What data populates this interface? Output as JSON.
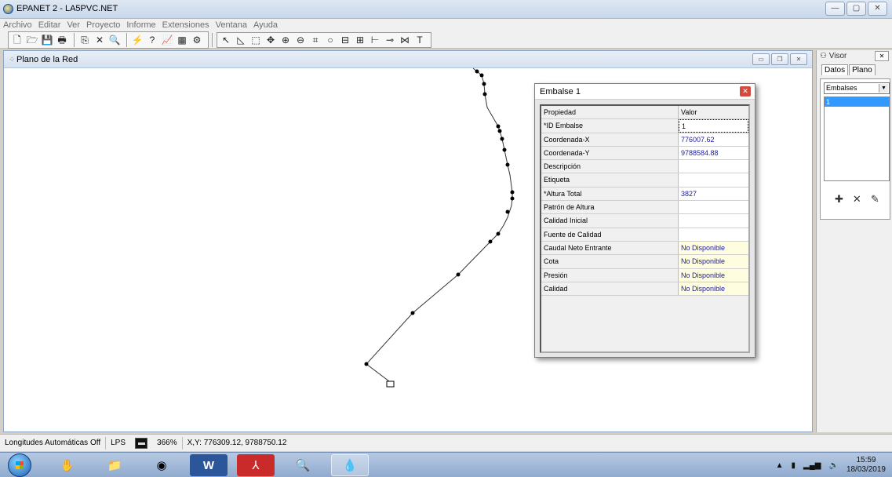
{
  "app": {
    "title": "EPANET 2 - LA5PVC.NET",
    "window_buttons": [
      "—",
      "▢",
      "✕"
    ]
  },
  "menu": [
    "Archivo",
    "Editar",
    "Ver",
    "Proyecto",
    "Informe",
    "Extensiones",
    "Ventana",
    "Ayuda"
  ],
  "network_window": {
    "title": "Plano de la Red"
  },
  "dialog": {
    "title": "Embalse 1",
    "header": {
      "name": "Propiedad",
      "value": "Valor"
    },
    "rows": [
      {
        "name": "*ID Embalse",
        "value": "1"
      },
      {
        "name": "Coordenada-X",
        "value": "776007.62"
      },
      {
        "name": "Coordenada-Y",
        "value": "9788584.88"
      },
      {
        "name": "Descripción",
        "value": ""
      },
      {
        "name": "Etiqueta",
        "value": ""
      },
      {
        "name": "*Altura Total",
        "value": "3827"
      },
      {
        "name": "Patrón de Altura",
        "value": ""
      },
      {
        "name": "Calidad Inicial",
        "value": ""
      },
      {
        "name": "Fuente de Calidad",
        "value": ""
      },
      {
        "name": "Caudal Neto Entrante",
        "value": "No Disponible"
      },
      {
        "name": "Cota",
        "value": "No Disponible"
      },
      {
        "name": "Presión",
        "value": "No Disponible"
      },
      {
        "name": "Calidad",
        "value": "No Disponible"
      }
    ]
  },
  "visor": {
    "title": "Visor",
    "tabs": [
      "Datos",
      "Plano"
    ],
    "selected_category": "Embalses",
    "items": [
      "1"
    ]
  },
  "status": {
    "auto_length": "Longitudes Automáticas Off",
    "flow_units": "LPS",
    "zoom": "366%",
    "coordinates": "X,Y: 776309.12, 9788750.12"
  },
  "taskbar": {
    "time": "15:59",
    "date": "18/03/2019"
  }
}
